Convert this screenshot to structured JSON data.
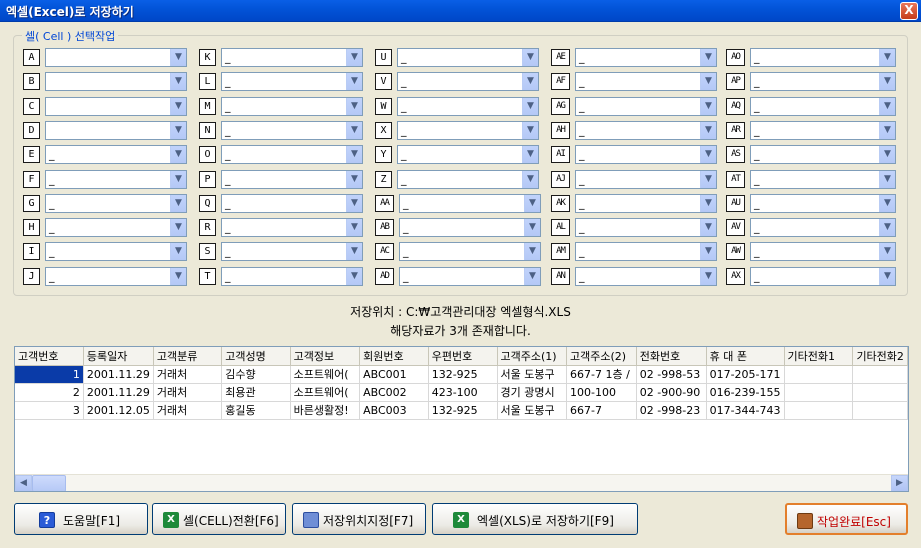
{
  "window": {
    "title": "엑셀(Excel)로 저장하기",
    "close_label": "X"
  },
  "group": {
    "legend": "셀( Cell ) 선택작업"
  },
  "cells": {
    "col1": [
      {
        "label": "A",
        "value": ""
      },
      {
        "label": "B",
        "value": ""
      },
      {
        "label": "C",
        "value": ""
      },
      {
        "label": "D",
        "value": ""
      },
      {
        "label": "E",
        "value": "_"
      },
      {
        "label": "F",
        "value": "_"
      },
      {
        "label": "G",
        "value": "_"
      },
      {
        "label": "H",
        "value": "_"
      },
      {
        "label": "I",
        "value": "_"
      },
      {
        "label": "J",
        "value": "_"
      }
    ],
    "col2": [
      {
        "label": "K",
        "value": "_"
      },
      {
        "label": "L",
        "value": "_"
      },
      {
        "label": "M",
        "value": "_"
      },
      {
        "label": "N",
        "value": "_"
      },
      {
        "label": "O",
        "value": "_"
      },
      {
        "label": "P",
        "value": "_"
      },
      {
        "label": "Q",
        "value": "_"
      },
      {
        "label": "R",
        "value": "_"
      },
      {
        "label": "S",
        "value": "_"
      },
      {
        "label": "T",
        "value": "_"
      }
    ],
    "col3": [
      {
        "label": "U",
        "value": "_"
      },
      {
        "label": "V",
        "value": "_"
      },
      {
        "label": "W",
        "value": "_"
      },
      {
        "label": "X",
        "value": "_"
      },
      {
        "label": "Y",
        "value": "_"
      },
      {
        "label": "Z",
        "value": "_"
      },
      {
        "label": "AA",
        "value": "_"
      },
      {
        "label": "AB",
        "value": "_"
      },
      {
        "label": "AC",
        "value": "_"
      },
      {
        "label": "AD",
        "value": "_"
      }
    ],
    "col4": [
      {
        "label": "AE",
        "value": "_"
      },
      {
        "label": "AF",
        "value": "_"
      },
      {
        "label": "AG",
        "value": "_"
      },
      {
        "label": "AH",
        "value": "_"
      },
      {
        "label": "AI",
        "value": "_"
      },
      {
        "label": "AJ",
        "value": "_"
      },
      {
        "label": "AK",
        "value": "_"
      },
      {
        "label": "AL",
        "value": "_"
      },
      {
        "label": "AM",
        "value": "_"
      },
      {
        "label": "AN",
        "value": "_"
      }
    ],
    "col5": [
      {
        "label": "AO",
        "value": "_"
      },
      {
        "label": "AP",
        "value": "_"
      },
      {
        "label": "AQ",
        "value": "_"
      },
      {
        "label": "AR",
        "value": "_"
      },
      {
        "label": "AS",
        "value": "_"
      },
      {
        "label": "AT",
        "value": "_"
      },
      {
        "label": "AU",
        "value": "_"
      },
      {
        "label": "AV",
        "value": "_"
      },
      {
        "label": "AW",
        "value": "_"
      },
      {
        "label": "AX",
        "value": "_"
      }
    ]
  },
  "info": {
    "save_path": "저장위치 : C:₩고객관리대장 엑셀형식.XLS",
    "record_count": "해당자료가 3개 존재합니다."
  },
  "grid": {
    "columns": [
      "고객번호",
      "등록일자",
      "고객분류",
      "고객성명",
      "고객정보",
      "회원번호",
      "우편번호",
      "고객주소(1)",
      "고객주소(2)",
      "전화번호",
      "휴 대 폰",
      "기타전화1",
      "기타전화2"
    ],
    "rows": [
      [
        "1",
        "2001.11.29",
        "거래처",
        "김수향",
        "소프트웨어(",
        "ABC001",
        "132-925",
        "서울 도봉구",
        "667-7 1층 /",
        "02  -998-53",
        "017-205-171",
        "",
        ""
      ],
      [
        "2",
        "2001.11.29",
        "거래처",
        "최용관",
        "소프트웨어(",
        "ABC002",
        "423-100",
        "경기 광명시",
        "100-100",
        "02  -900-90",
        "016-239-155",
        "",
        ""
      ],
      [
        "3",
        "2001.12.05",
        "거래처",
        "홍길동",
        "바른생활정!",
        "ABC003",
        "132-925",
        "서울 도봉구",
        "667-7",
        "02  -998-23",
        "017-344-743",
        "",
        ""
      ]
    ]
  },
  "buttons": {
    "help": "도움말[F1]",
    "cell_convert": "셀(CELL)전환[F6]",
    "save_location": "저장위치지정[F7]",
    "save_excel": "엑셀(XLS)로 저장하기[F9]",
    "done": "작업완료[Esc]"
  },
  "colors": {
    "title_bar": "#0254D8",
    "legend": "#0046D5",
    "selected_cell": "#0A3BA8",
    "done_text": "#C00000"
  }
}
